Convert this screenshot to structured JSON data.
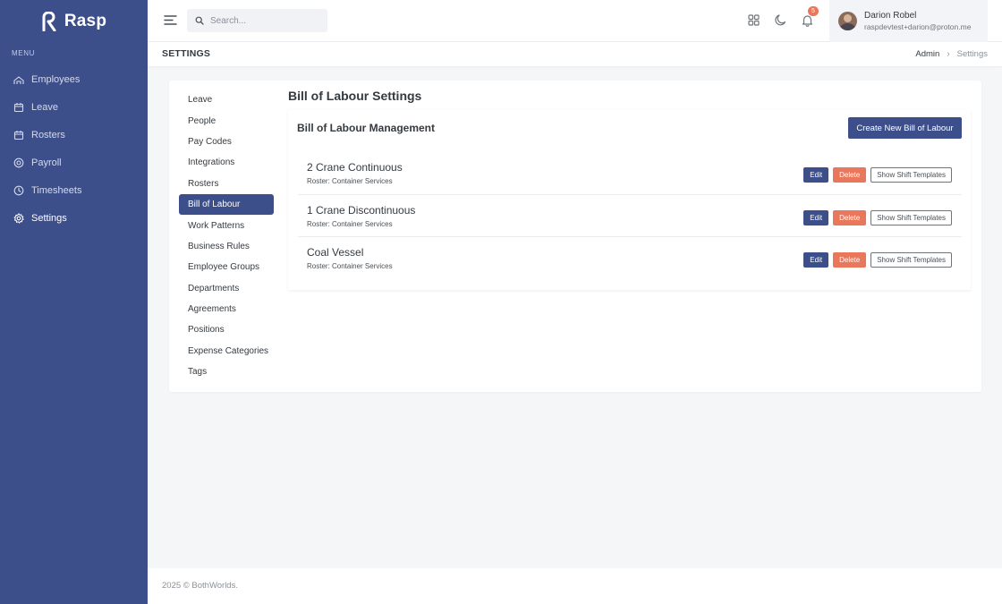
{
  "brand": {
    "name": "Rasp"
  },
  "sidebar": {
    "menu_title": "MENU",
    "items": [
      {
        "label": "Employees",
        "icon": "users-icon"
      },
      {
        "label": "Leave",
        "icon": "calendar-icon"
      },
      {
        "label": "Rosters",
        "icon": "calendar-icon"
      },
      {
        "label": "Payroll",
        "icon": "dollar-circle-icon"
      },
      {
        "label": "Timesheets",
        "icon": "clock-icon"
      },
      {
        "label": "Settings",
        "icon": "gear-icon",
        "active": true
      }
    ]
  },
  "topbar": {
    "search_placeholder": "Search...",
    "notification_count": "5",
    "user": {
      "name": "Darion Robel",
      "email": "raspdevtest+darion@proton.me"
    }
  },
  "page": {
    "title": "SETTINGS",
    "breadcrumb": {
      "parent": "Admin",
      "current": "Settings"
    }
  },
  "settings_nav": {
    "items": [
      "Leave",
      "People",
      "Pay Codes",
      "Integrations",
      "Rosters",
      "Bill of Labour",
      "Work Patterns",
      "Business Rules",
      "Employee Groups",
      "Departments",
      "Agreements",
      "Positions",
      "Expense Categories",
      "Tags"
    ],
    "active": "Bill of Labour"
  },
  "main": {
    "section_title": "Bill of Labour Settings",
    "management_title": "Bill of Labour Management",
    "create_label": "Create New Bill of Labour",
    "actions": {
      "edit": "Edit",
      "delete": "Delete",
      "templates": "Show Shift Templates"
    },
    "bills": [
      {
        "name": "2 Crane Continuous",
        "roster": "Roster: Container Services"
      },
      {
        "name": "1 Crane Discontinuous",
        "roster": "Roster: Container Services"
      },
      {
        "name": "Coal Vessel",
        "roster": "Roster: Container Services"
      }
    ]
  },
  "footer": {
    "text": "2025 © BothWorlds."
  },
  "colors": {
    "primary": "#3d4f8a",
    "danger": "#e9775c",
    "background": "#f5f6f8"
  }
}
